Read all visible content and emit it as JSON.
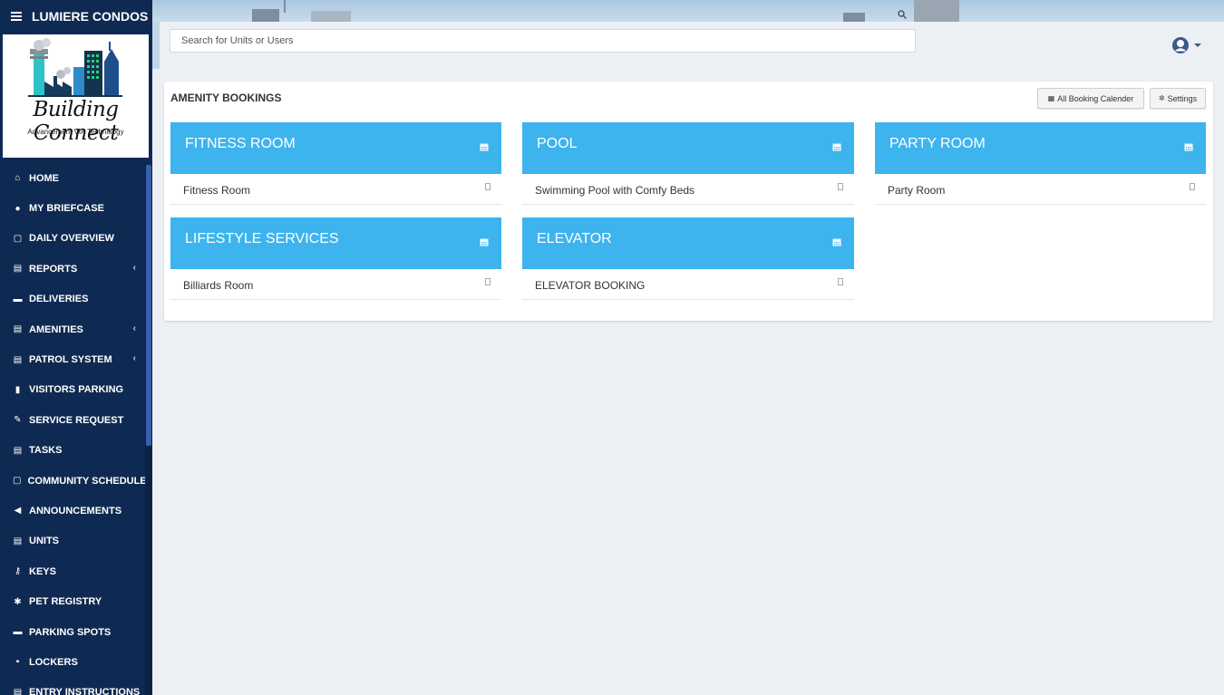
{
  "sidebar": {
    "brand": "LUMIERE CONDOS",
    "logo": {
      "title": "Building Connect",
      "tagline": "Advancement VIA Technology"
    },
    "items": [
      {
        "label": "HOME",
        "icon": "home-icon",
        "glyph": "⌂",
        "chevron": false
      },
      {
        "label": "MY BRIEFCASE",
        "icon": "globe-icon",
        "glyph": "●",
        "chevron": false
      },
      {
        "label": "DAILY OVERVIEW",
        "icon": "calendar-icon",
        "glyph": "▢",
        "chevron": false
      },
      {
        "label": "REPORTS",
        "icon": "list-icon",
        "glyph": "▤",
        "chevron": true
      },
      {
        "label": "DELIVERIES",
        "icon": "truck-icon",
        "glyph": "▬",
        "chevron": false
      },
      {
        "label": "AMENITIES",
        "icon": "list-icon",
        "glyph": "▤",
        "chevron": true
      },
      {
        "label": "PATROL SYSTEM",
        "icon": "list-icon",
        "glyph": "▤",
        "chevron": true
      },
      {
        "label": "VISITORS PARKING",
        "icon": "building-icon",
        "glyph": "▮",
        "chevron": false
      },
      {
        "label": "SERVICE REQUEST",
        "icon": "wrench-icon",
        "glyph": "✎",
        "chevron": false
      },
      {
        "label": "TASKS",
        "icon": "list-icon",
        "glyph": "▤",
        "chevron": false
      },
      {
        "label": "COMMUNITY SCHEDULE",
        "icon": "calendar-icon",
        "glyph": "▢",
        "chevron": false
      },
      {
        "label": "ANNOUNCEMENTS",
        "icon": "bullhorn-icon",
        "glyph": "◀",
        "chevron": false
      },
      {
        "label": "UNITS",
        "icon": "list-icon",
        "glyph": "▤",
        "chevron": false
      },
      {
        "label": "KEYS",
        "icon": "key-icon",
        "glyph": "⚷",
        "chevron": false
      },
      {
        "label": "PET REGISTRY",
        "icon": "paw-icon",
        "glyph": "✱",
        "chevron": false
      },
      {
        "label": "PARKING SPOTS",
        "icon": "car-icon",
        "glyph": "▬",
        "chevron": false
      },
      {
        "label": "LOCKERS",
        "icon": "lock-icon",
        "glyph": "▪",
        "chevron": false
      },
      {
        "label": "ENTRY INSTRUCTIONS",
        "icon": "list-icon",
        "glyph": "▤",
        "chevron": false
      }
    ]
  },
  "search": {
    "placeholder": "Search for Units or Users"
  },
  "main": {
    "title": "AMENITY BOOKINGS",
    "buttons": {
      "all_booking": "All Booking Calender",
      "settings": "Settings"
    },
    "cards": [
      {
        "title": "FITNESS ROOM",
        "description": "Fitness Room"
      },
      {
        "title": "POOL",
        "description": "Swimming Pool with Comfy Beds"
      },
      {
        "title": "PARTY ROOM",
        "description": "Party Room"
      },
      {
        "title": "LIFESTYLE SERVICES",
        "description": "Billiards Room"
      },
      {
        "title": "ELEVATOR",
        "description": "ELEVATOR BOOKING"
      }
    ]
  },
  "colors": {
    "sidebar": "#0f2a52",
    "card_header": "#3db4ee",
    "background": "#ecf0f5"
  }
}
